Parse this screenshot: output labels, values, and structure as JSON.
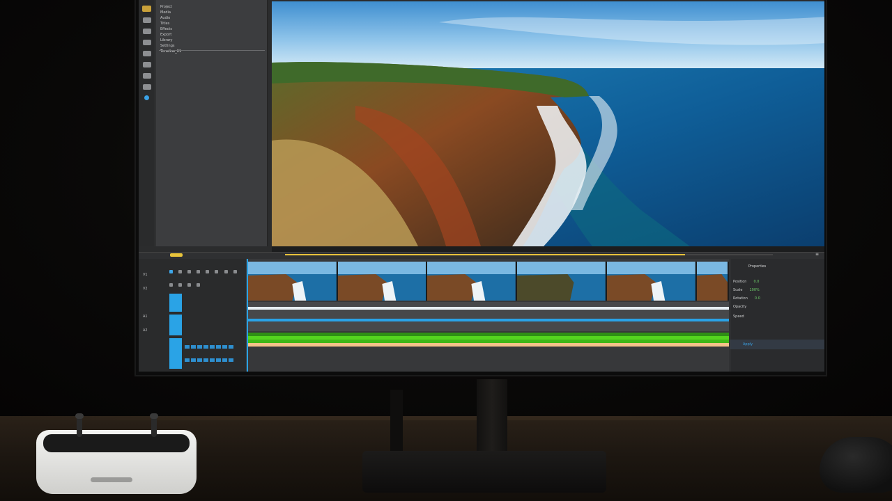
{
  "file_panel": {
    "items": [
      "Project",
      "Media",
      "Audio",
      "Titles",
      "Effects",
      "Export",
      "Library",
      "Settings",
      "Timeline_01"
    ]
  },
  "timeline": {
    "options_label": "≡",
    "playhead_progress": 0.0,
    "progress_fill": 0.82,
    "track_labels": [
      "V1",
      "V2",
      "A1",
      "A2"
    ]
  },
  "properties": {
    "title": "Properties",
    "rows": [
      {
        "label": "Position",
        "value": "0.0"
      },
      {
        "label": "Scale",
        "value": "100%"
      },
      {
        "label": "Rotation",
        "value": "0.0"
      },
      {
        "label": "Opacity",
        "value": ""
      },
      {
        "label": "Speed",
        "value": ""
      }
    ],
    "footer_label": "Apply"
  },
  "colors": {
    "accent": "#2aa3e6",
    "audio_green": "#44c21a",
    "audio_orange": "#f4c28a",
    "handle_yellow": "#e9c43b"
  },
  "icons": [
    "folder-icon",
    "film-icon",
    "audio-icon",
    "text-icon",
    "effects-icon",
    "export-icon",
    "library-icon",
    "settings-icon",
    "select-icon"
  ]
}
